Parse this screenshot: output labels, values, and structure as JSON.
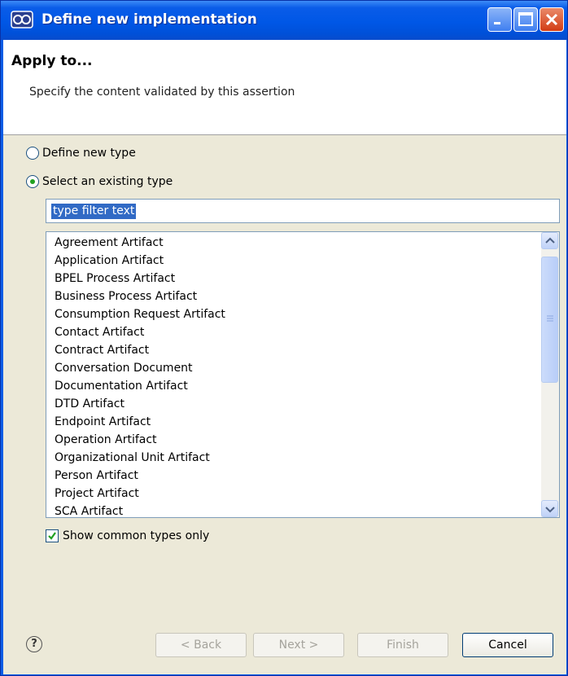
{
  "window": {
    "title": "Define new implementation"
  },
  "header": {
    "title": "Apply to...",
    "description": "Specify the content validated by this assertion"
  },
  "options": {
    "define_new_type": {
      "label": "Define new type",
      "selected": false
    },
    "select_existing_type": {
      "label": "Select an existing type",
      "selected": true
    }
  },
  "filter": {
    "value": "type filter text"
  },
  "types": [
    "Agreement Artifact",
    "Application Artifact",
    "BPEL Process Artifact",
    "Business Process Artifact",
    "Consumption Request Artifact",
    "Contact Artifact",
    "Contract Artifact",
    "Conversation Document",
    "Documentation Artifact",
    "DTD Artifact",
    "Endpoint Artifact",
    "Operation Artifact",
    "Organizational Unit Artifact",
    "Person Artifact",
    "Project Artifact",
    "SCA Artifact"
  ],
  "show_common": {
    "label": "Show common types only",
    "checked": true
  },
  "buttons": {
    "back": "< Back",
    "next": "Next >",
    "finish": "Finish",
    "cancel": "Cancel"
  },
  "colors": {
    "title_bar": "#0057e6",
    "selection": "#316ac5",
    "dialog_bg": "#ece9d8"
  }
}
